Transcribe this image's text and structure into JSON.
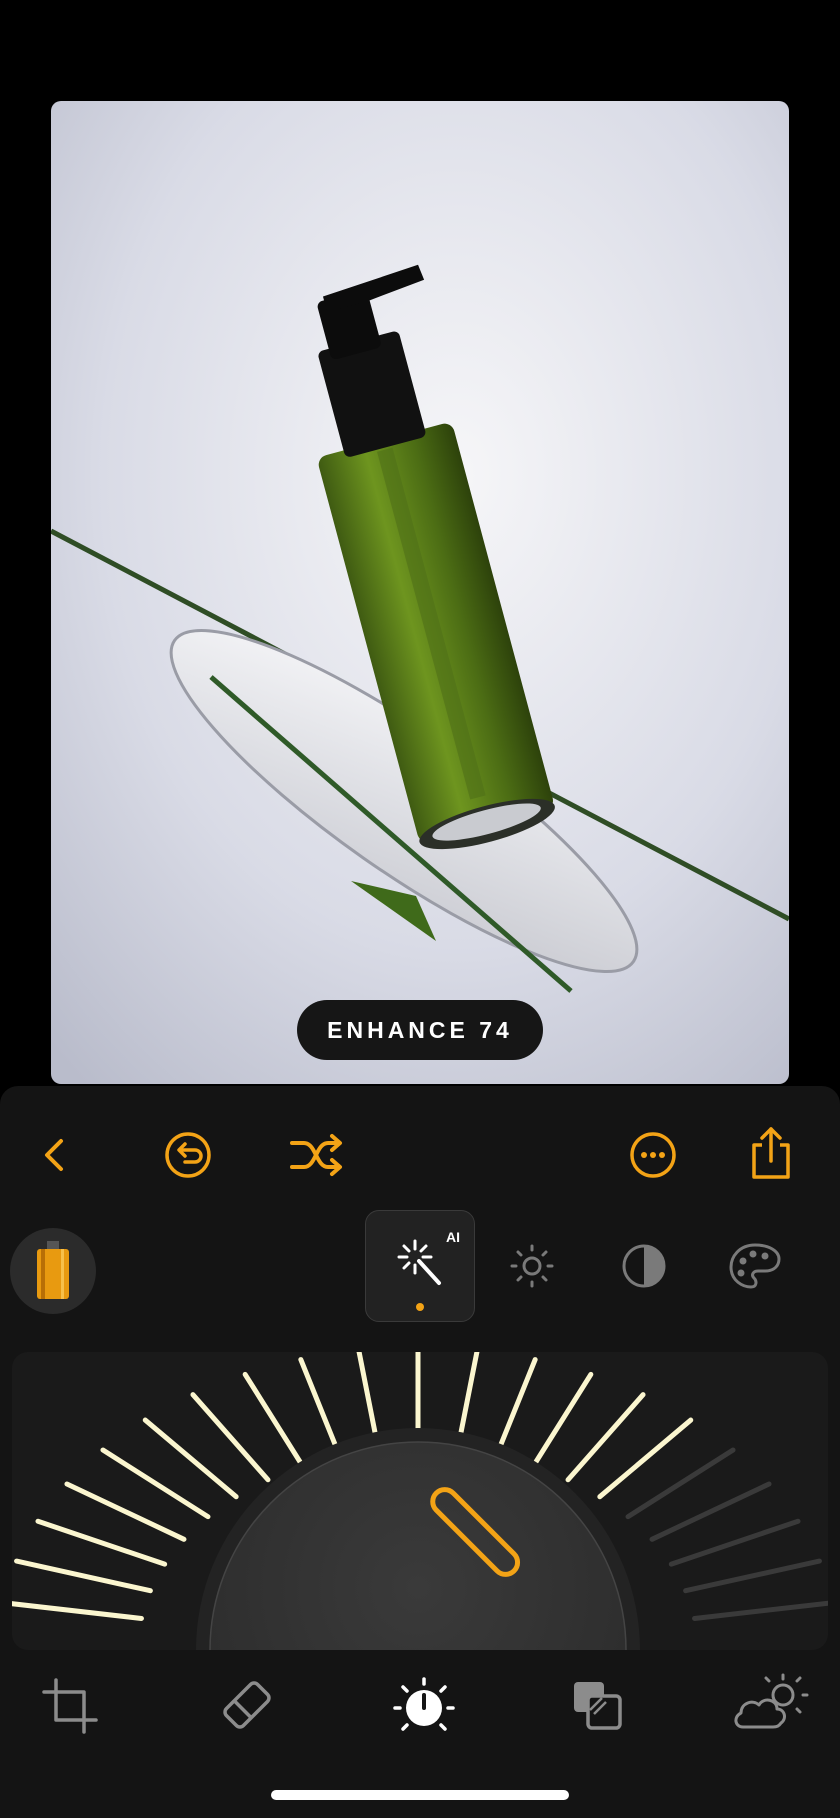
{
  "photo": {
    "description": "green-bottle-product-photo",
    "overlay_label": "ENHANCE 74"
  },
  "toolbar": {
    "back": "chevron-left-icon",
    "undo": "undo-icon",
    "shuffle": "shuffle-icon",
    "more": "more-icon",
    "share": "share-icon",
    "accent_color": "#f3a316"
  },
  "adjust_tabs": {
    "film": "film-roll-icon",
    "ai_badge": "AI",
    "items": [
      {
        "name": "magic-wand-icon",
        "selected": true
      },
      {
        "name": "brightness-icon",
        "selected": false
      },
      {
        "name": "contrast-icon",
        "selected": false
      },
      {
        "name": "palette-icon",
        "selected": false
      }
    ]
  },
  "dial": {
    "value": 74
  },
  "bottom_nav": [
    {
      "name": "crop-icon"
    },
    {
      "name": "eraser-icon"
    },
    {
      "name": "adjust-dial-icon",
      "selected": true
    },
    {
      "name": "layers-icon"
    },
    {
      "name": "weather-icon"
    }
  ]
}
